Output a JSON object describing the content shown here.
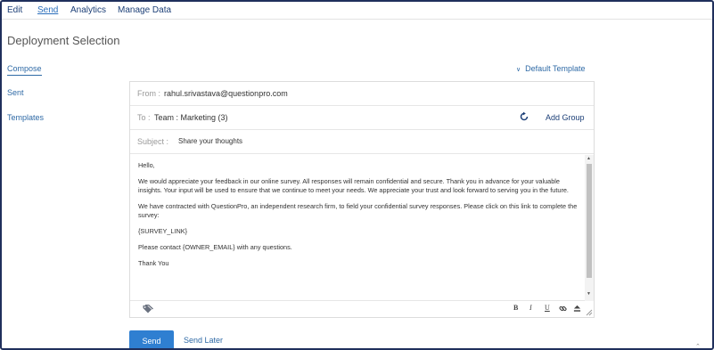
{
  "topnav": {
    "items": [
      {
        "label": "Edit"
      },
      {
        "label": "Send"
      },
      {
        "label": "Analytics"
      },
      {
        "label": "Manage Data"
      }
    ],
    "active": "Send"
  },
  "page_title": "Deployment Selection",
  "sidenav": {
    "items": [
      {
        "label": "Compose"
      },
      {
        "label": "Sent"
      },
      {
        "label": "Templates"
      }
    ],
    "active": "Compose"
  },
  "template_selector": {
    "label": "Default Template",
    "icon": "chevron-down-icon"
  },
  "email": {
    "from_label": "From :",
    "from_value": "rahul.srivastava@questionpro.com",
    "to_label": "To :",
    "to_value": "Team : Marketing (3)",
    "add_group_label": "Add Group",
    "subject_label": "Subject :",
    "subject_value": "Share your thoughts",
    "body": [
      "Hello,",
      "We would appreciate your feedback in our online survey.  All responses will remain confidential and secure.  Thank you in advance for your valuable insights.  Your input will be used to ensure that we continue to meet your needs. We appreciate your trust and look forward to serving you in the future.",
      "We have contracted with QuestionPro, an independent research firm, to field your confidential survey responses.  Please click on this link to complete the survey:",
      "{SURVEY_LINK}",
      "Please contact {OWNER_EMAIL} with any questions.",
      "Thank You"
    ]
  },
  "editor_toolbar": {
    "bold": "B",
    "italic": "I",
    "underline": "U"
  },
  "actions": {
    "send_label": "Send",
    "send_later_label": "Send Later"
  },
  "colors": {
    "accent": "#2f7fd1",
    "link": "#2f6aa6",
    "frame": "#1f2f5c"
  }
}
